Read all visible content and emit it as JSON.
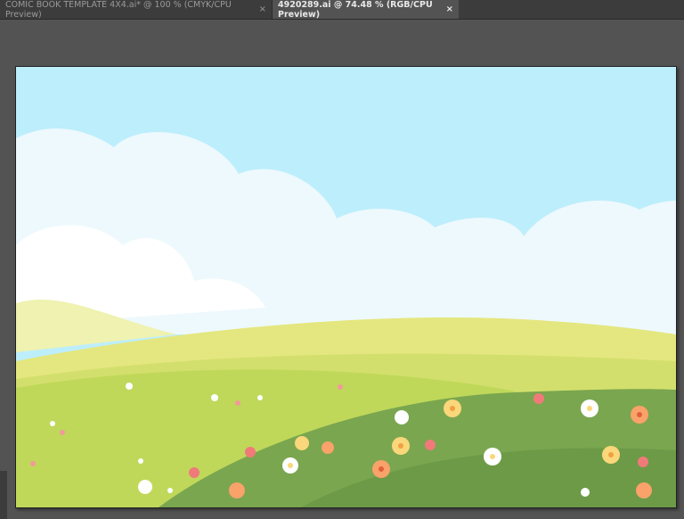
{
  "tabs": [
    {
      "label": "COMIC BOOK TEMPLATE 4X4.ai* @ 100 % (CMYK/CPU Preview)",
      "close": "×",
      "active": false
    },
    {
      "label": "4920289.ai @ 74.48 % (RGB/CPU Preview)",
      "close": "×",
      "active": true
    }
  ],
  "colors": {
    "sky": "#bdeefc",
    "cloud": "#ffffff",
    "hill_far": "#e6e98a",
    "hill_mid": "#c8d95c",
    "grass": "#7ba74f"
  }
}
